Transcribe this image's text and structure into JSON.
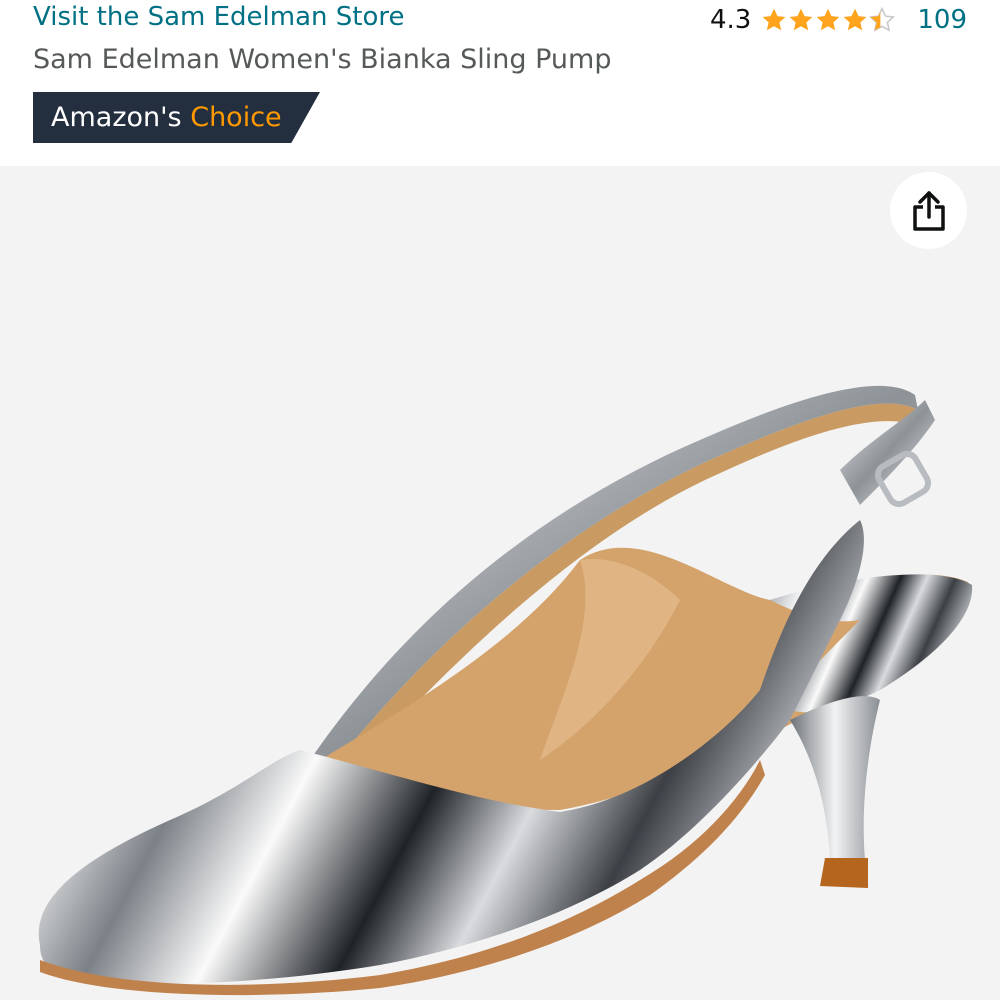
{
  "header": {
    "store_link": "Visit the Sam Edelman Store",
    "product_title": "Sam Edelman Women's Bianka Sling Pump",
    "rating_value": "4.3",
    "rating_stars": 4.3,
    "rating_count": "109",
    "badge_prefix": "Amazon's",
    "badge_highlight": "Choice"
  },
  "icons": {
    "star": "star-icon",
    "share": "share-icon"
  },
  "colors": {
    "link": "#007185",
    "star": "#ffa41c",
    "badge_bg": "#232f3e",
    "badge_accent": "#ff9900",
    "image_bg": "#f3f3f3"
  },
  "image": {
    "subject": "silver metallic kitten-heel slingback pump"
  }
}
